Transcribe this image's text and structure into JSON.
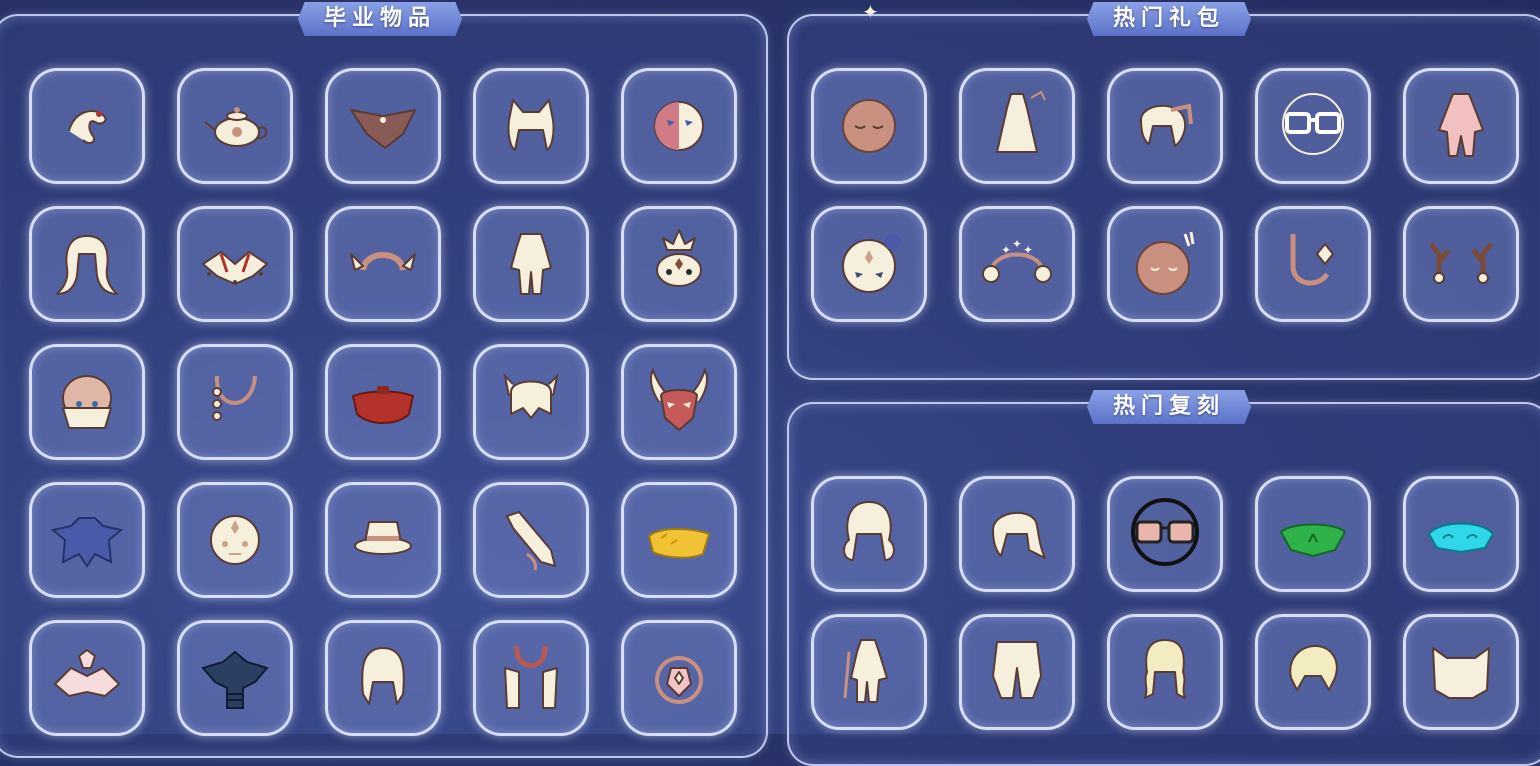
{
  "panels": {
    "graduation": {
      "title": "毕业物品",
      "items": [
        "feather-hairpin-icon",
        "teapot-prop-icon",
        "owl-wing-cape-icon",
        "cat-ear-hair-icon",
        "half-mask-icon",
        "long-hair-icon",
        "lotus-cape-icon",
        "wing-headband-icon",
        "fisherman-outfit-icon",
        "crowned-mask-icon",
        "bald-cap-mask-icon",
        "beaded-necklace-icon",
        "red-cape-icon",
        "pigtail-hair-icon",
        "horned-mask-icon",
        "blue-cape-icon",
        "tribal-mask-icon",
        "feather-hat-icon",
        "horn-instrument-icon",
        "yellow-scarf-icon",
        "pink-flower-cape-icon",
        "armored-cape-icon",
        "bob-hair-icon",
        "shoulder-scarf-icon",
        "amulet-prop-icon"
      ]
    },
    "hot_packs": {
      "title": "热门礼包",
      "items": [
        "sleepy-mask-icon",
        "white-dress-outfit-icon",
        "ponytail-hair-icon",
        "glasses-icon",
        "pink-outfit-icon",
        "white-mask-icon",
        "moon-star-headband-icon",
        "round-face-mask-icon",
        "earring-necklace-icon",
        "antler-headpiece-icon"
      ]
    },
    "hot_rerun": {
      "title": "热门复刻",
      "items": [
        "twin-curl-hair-icon",
        "side-ponytail-hair-icon",
        "sunglasses-icon",
        "green-cape-icon",
        "cyan-cape-icon",
        "traveler-outfit-icon",
        "baggy-pants-icon",
        "wavy-hair-icon",
        "short-hair-icon",
        "cat-ear-hood-icon"
      ]
    }
  },
  "colors": {
    "background": "#2c3870",
    "panel_border": "#d7e1ff",
    "slot_fill": "#6e7dbe",
    "title_tab": "#6f86d6",
    "cream": "#f6efdc",
    "skin_pink": "#c9907f",
    "accent_red": "#b3332a",
    "accent_green": "#2fb24a",
    "accent_cyan": "#2fd7e8",
    "accent_yellow": "#f0c234",
    "dark_navy": "#2b3f63",
    "blue_cape": "#4a5aa8"
  }
}
